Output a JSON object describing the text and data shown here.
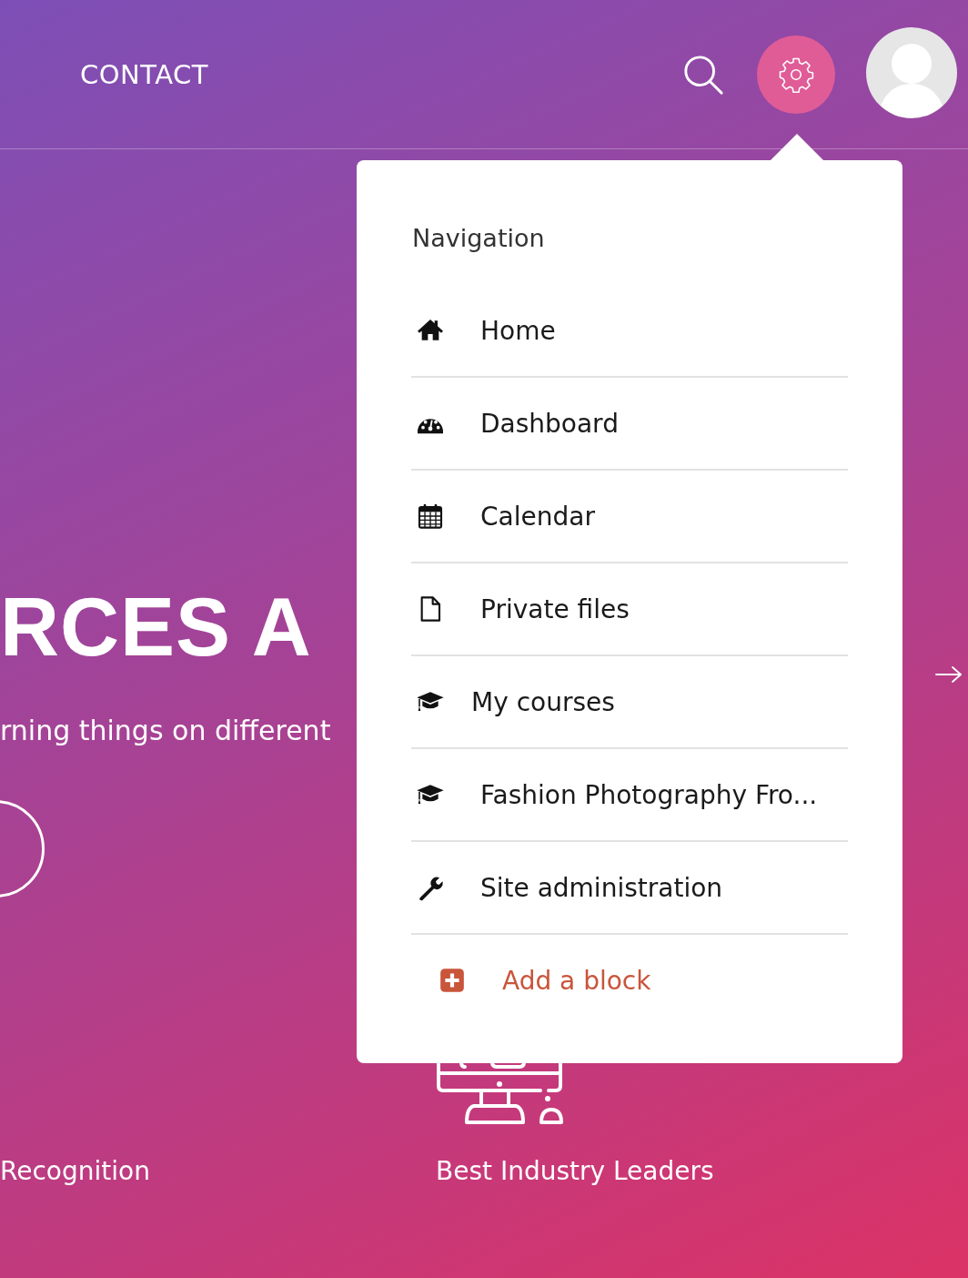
{
  "header": {
    "nav_link": "CONTACT"
  },
  "hero": {
    "title": "RCES A",
    "subtitle": "rning things on different"
  },
  "features": [
    {
      "caption": "Recognition"
    },
    {
      "caption": "Best Industry Leaders"
    }
  ],
  "menu": {
    "heading": "Navigation",
    "items": [
      {
        "kind": "link",
        "label": "Home"
      },
      {
        "kind": "link",
        "label": "Dashboard"
      },
      {
        "kind": "link",
        "label": "Calendar"
      },
      {
        "kind": "link",
        "label": "Private files"
      },
      {
        "kind": "link",
        "label": "My courses"
      },
      {
        "kind": "link",
        "label": "Fashion Photography Fro..."
      },
      {
        "kind": "link",
        "label": "Site administration"
      },
      {
        "kind": "action",
        "label": "Add a block"
      }
    ]
  }
}
